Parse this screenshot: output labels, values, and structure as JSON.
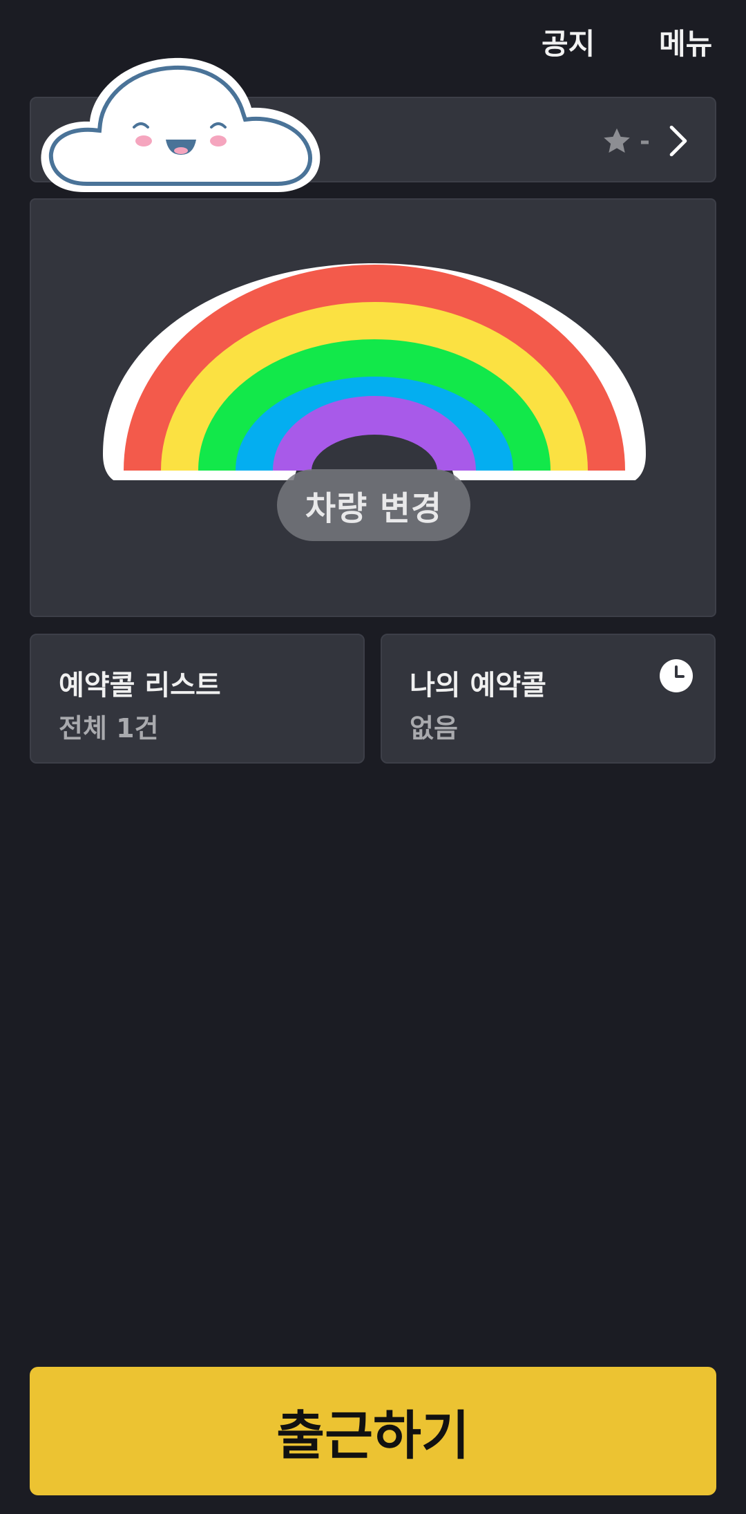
{
  "header": {
    "notice_label": "공지",
    "menu_label": "메뉴"
  },
  "vehicle": {
    "rating": "-",
    "star_icon": "star-icon",
    "chevron_icon": "chevron-right-icon",
    "sticker": "cloud-sticker",
    "image": "rainbow-sticker",
    "change_label": "차량 변경"
  },
  "cards": {
    "reservation_list": {
      "title": "예약콜 리스트",
      "subtitle": "전체 1건"
    },
    "my_reservation": {
      "title": "나의 예약콜",
      "subtitle": "없음",
      "icon": "clock-icon"
    }
  },
  "cta": {
    "start_label": "출근하기"
  },
  "colors": {
    "background": "#1b1c23",
    "card": "#33353d",
    "accent": "#ecc332"
  }
}
